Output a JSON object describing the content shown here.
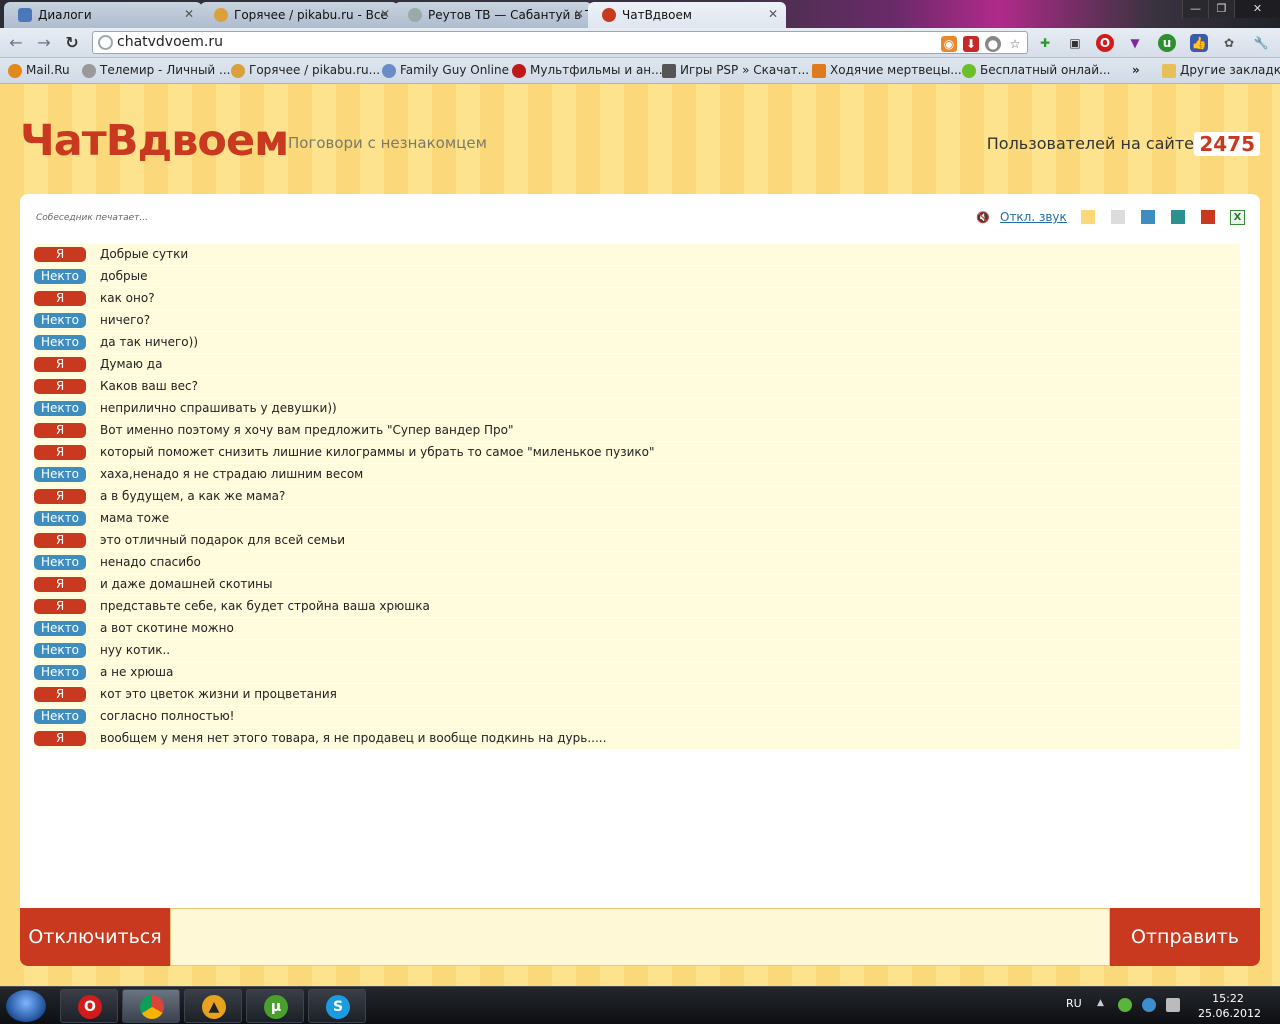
{
  "browser": {
    "tabs": [
      {
        "title": "Диалоги",
        "icon": "dialog-icon",
        "active": false
      },
      {
        "title": "Горячее / pikabu.ru - Все",
        "icon": "pikabu-icon",
        "active": false
      },
      {
        "title": "Реутов ТВ — Сабантуй в Т",
        "icon": "globe-icon",
        "active": false
      },
      {
        "title": "ЧатВдвоем",
        "icon": "chat-icon",
        "active": true
      }
    ],
    "url": "chatvdvoem.ru",
    "bookmarks": [
      {
        "label": "Mail.Ru"
      },
      {
        "label": "Телемир - Личный ..."
      },
      {
        "label": "Горячее / pikabu.ru..."
      },
      {
        "label": "Family Guy Online"
      },
      {
        "label": "Мультфильмы и ан..."
      },
      {
        "label": "Игры PSP » Скачат..."
      },
      {
        "label": "Ходячие мертвецы...."
      },
      {
        "label": "Бесплатный онлай..."
      }
    ],
    "bookmarks_overflow": "»",
    "other_bookmarks": "Другие закладки"
  },
  "site": {
    "logo": "ЧатВдвоем",
    "tagline": "Поговори с незнакомцем",
    "users_label": "Пользователей на сайте",
    "users_count": "2475",
    "typing_status": "Собеседник печатает...",
    "sound_toggle": "Откл. звук",
    "colors": {
      "accent": "#c8391f",
      "stranger": "#3d8dc0",
      "background_stripe_a": "#fbd97a",
      "background_stripe_b": "#fde38e",
      "message_bg": "#fffbdd"
    },
    "theme_swatches": [
      "#fbd97a",
      "#dcdcdc",
      "#3d8dc0",
      "#2a9090",
      "#c8391f"
    ],
    "disconnect_label": "Отключиться",
    "send_label": "Отправить"
  },
  "messages": [
    {
      "sender": "Я",
      "role": "me",
      "text": "Добрые сутки"
    },
    {
      "sender": "Некто",
      "role": "other",
      "text": "добрые"
    },
    {
      "sender": "Я",
      "role": "me",
      "text": "как оно?"
    },
    {
      "sender": "Некто",
      "role": "other",
      "text": "ничего?"
    },
    {
      "sender": "Некто",
      "role": "other",
      "text": "да так ничего))"
    },
    {
      "sender": "Я",
      "role": "me",
      "text": "Думаю да"
    },
    {
      "sender": "Я",
      "role": "me",
      "text": "Каков ваш вес?"
    },
    {
      "sender": "Некто",
      "role": "other",
      "text": "неприлично спрашивать у девушки))"
    },
    {
      "sender": "Я",
      "role": "me",
      "text": "Вот именно поэтому я хочу вам предложить \"Супер вандер Про\""
    },
    {
      "sender": "Я",
      "role": "me",
      "text": "который поможет снизить лишние килограммы и убрать то самое \"миленькое пузико\""
    },
    {
      "sender": "Некто",
      "role": "other",
      "text": "хаха,ненадо я не страдаю лишним весом"
    },
    {
      "sender": "Я",
      "role": "me",
      "text": "а в будущем, а как же мама?"
    },
    {
      "sender": "Некто",
      "role": "other",
      "text": "мама тоже"
    },
    {
      "sender": "Я",
      "role": "me",
      "text": "это отличный подарок для всей семьи"
    },
    {
      "sender": "Некто",
      "role": "other",
      "text": "ненадо спасибо"
    },
    {
      "sender": "Я",
      "role": "me",
      "text": "и даже домашней скотины"
    },
    {
      "sender": "Я",
      "role": "me",
      "text": "представьте себе, как будет стройна ваша хрюшка"
    },
    {
      "sender": "Некто",
      "role": "other",
      "text": "а вот скотине можно"
    },
    {
      "sender": "Некто",
      "role": "other",
      "text": "нуу котик.."
    },
    {
      "sender": "Некто",
      "role": "other",
      "text": "а не хрюша"
    },
    {
      "sender": "Я",
      "role": "me",
      "text": "кот это цветок жизни и процветания"
    },
    {
      "sender": "Некто",
      "role": "other",
      "text": "согласно полностью!"
    },
    {
      "sender": "Я",
      "role": "me",
      "text": "вообщем у меня нет этого товара, я не продавец и вообще подкинь на дурь....."
    }
  ],
  "taskbar": {
    "apps": [
      "opera-icon",
      "chrome-icon",
      "aimp-icon",
      "utorrent-icon",
      "skype-icon"
    ],
    "language": "RU",
    "time": "15:22",
    "date": "25.06.2012"
  }
}
